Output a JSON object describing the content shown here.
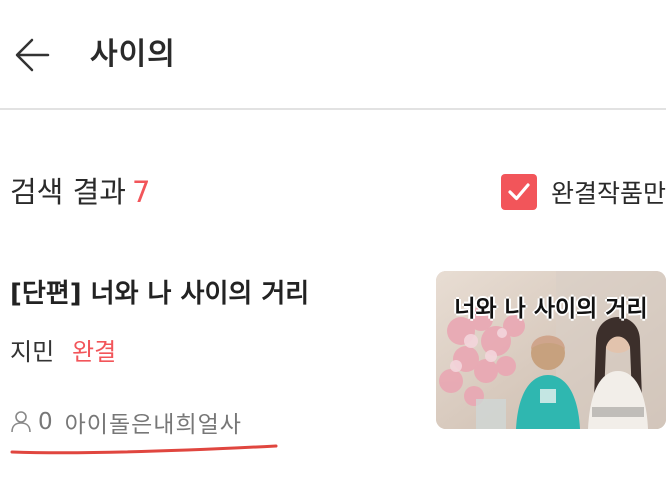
{
  "header": {
    "back_icon": "arrow-left-icon",
    "title": "사이의"
  },
  "results": {
    "label": "검색 결과",
    "count": "7",
    "filter": {
      "checked": true,
      "label": "완결작품만",
      "color": "#f2555a"
    }
  },
  "items": [
    {
      "title": "[단편] 너와 나 사이의 거리",
      "author": "지민",
      "status": "완결",
      "views": "0",
      "tags": "아이돌은내희얼사",
      "cover": {
        "title": "너와 나 사이의 거리"
      }
    }
  ],
  "colors": {
    "accent": "#f2555a",
    "divider": "#e2e2e2"
  }
}
